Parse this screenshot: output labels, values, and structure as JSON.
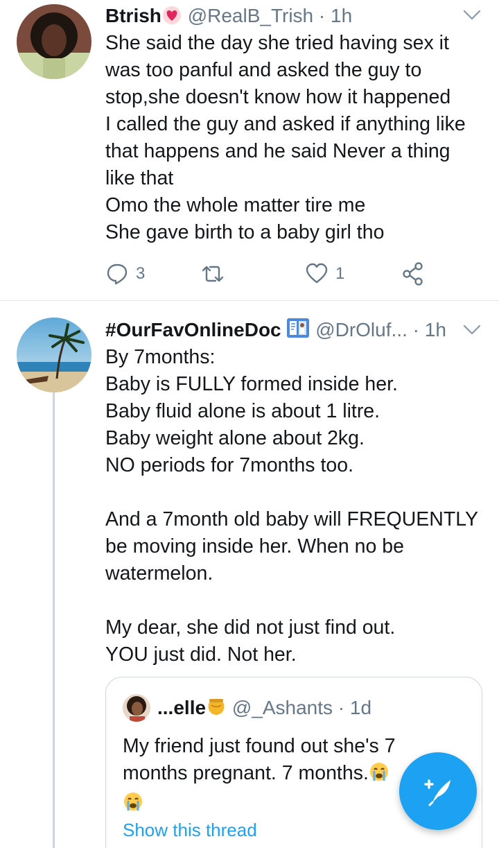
{
  "tweets": [
    {
      "author": {
        "name": "Btrish",
        "name_emoji": "heart-emoji",
        "handle": "@RealB_Trish",
        "separator": "·",
        "time": "1h"
      },
      "lines": [
        "She said the day she tried having sex it",
        "was too panful and asked the guy to",
        "stop,she doesn't know how it happened",
        "I called the guy and asked if anything like",
        "that happens and he said Never a thing",
        "like that",
        "Omo the whole matter tire me",
        "She gave birth to a baby girl tho"
      ],
      "actions": {
        "reply_count": "3",
        "retweet_count": "",
        "like_count": "1"
      }
    },
    {
      "author": {
        "name": "#OurFavOnlineDoc",
        "name_emoji": "doctor-emoji",
        "handle": "@DrOluf...",
        "separator": "·",
        "time": "1h"
      },
      "lines": [
        "By 7months:",
        "Baby is FULLY formed inside her.",
        "Baby fluid alone is about 1 litre.",
        "Baby weight alone about 2kg.",
        "NO periods for 7months too.",
        "",
        "And a 7month old baby will FREQUENTLY",
        "be moving inside her. When no be",
        "watermelon.",
        "",
        "My dear, she did not just find out.",
        "YOU just did. Not her."
      ],
      "quoted": {
        "name": "...elle",
        "name_emoji": "honey-pot-emoji",
        "handle": "@_Ashants",
        "separator": "·",
        "time": "1d",
        "lines": [
          "My friend just found out she's 7",
          "months pregnant.  7 months."
        ],
        "trailing_emoji": "crying-face-emoji",
        "show_thread": "Show this thread"
      }
    }
  ],
  "fab": {
    "icon": "compose-tweet-icon"
  },
  "colors": {
    "text": "#14171a",
    "secondary": "#657786",
    "accent": "#1da1f2",
    "border": "#e1e8ed",
    "heart_emoji": "#e0245e"
  }
}
